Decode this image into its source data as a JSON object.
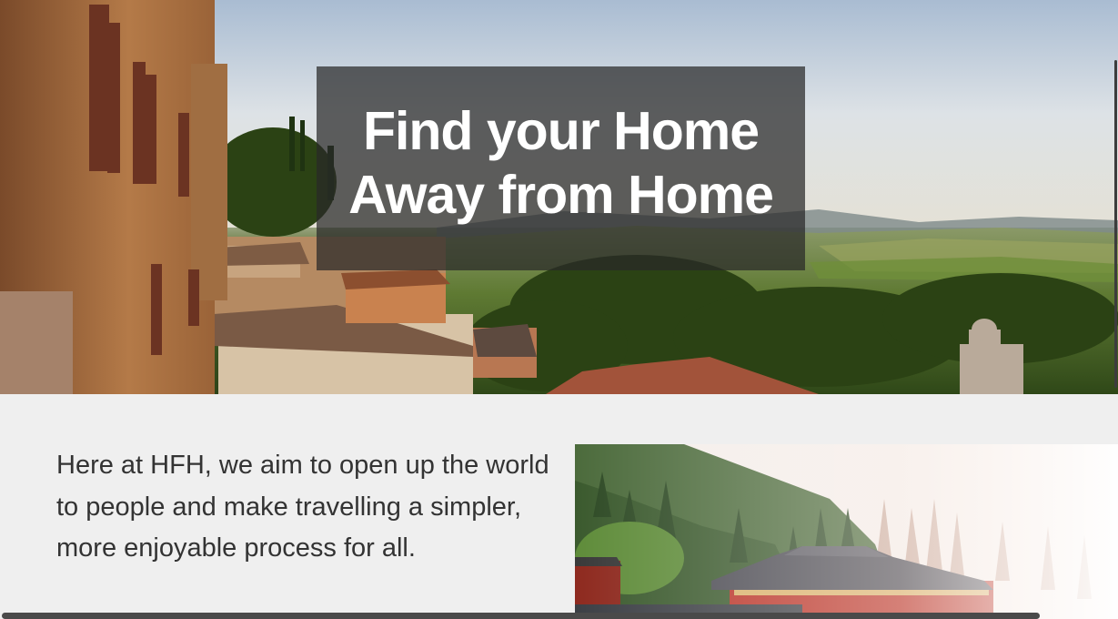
{
  "hero": {
    "title_line1": "Find your Home",
    "title_line2": "Away from Home"
  },
  "intro": {
    "text": "Here at HFH, we aim to open up the world to people and make travelling a simpler, more enjoyable process for all."
  },
  "images": {
    "hero_photo": "tuscany-hilltop-town-photo",
    "temple_photo": "japanese-temple-photo"
  }
}
